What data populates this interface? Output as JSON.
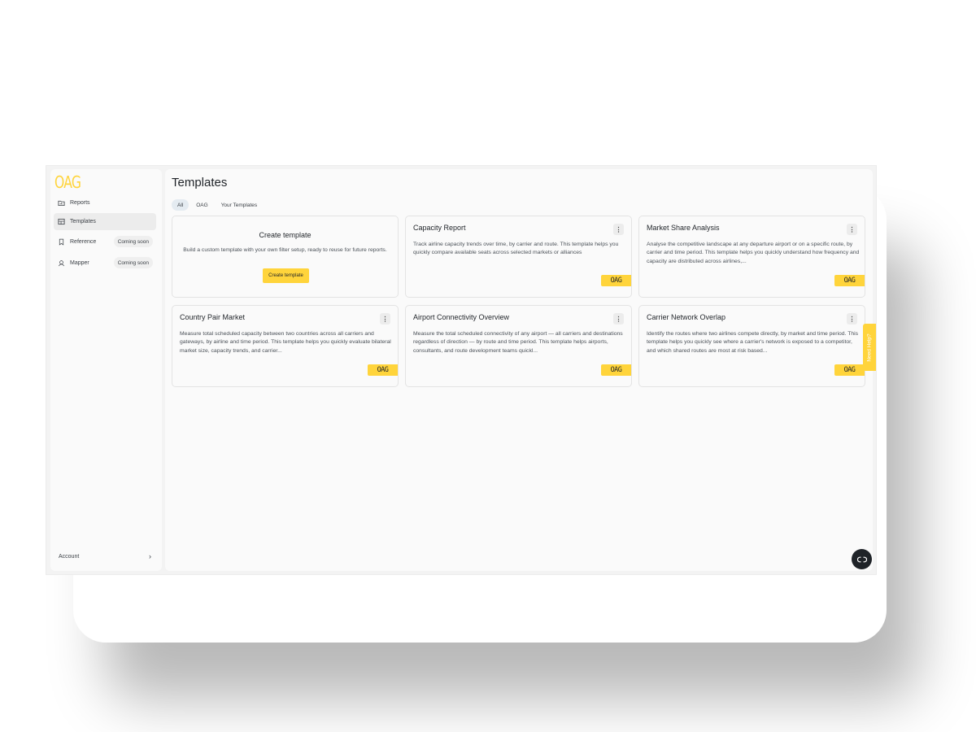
{
  "brand": {
    "logo_text": "OAG",
    "accent_color": "#ffd43b"
  },
  "sidebar": {
    "items": [
      {
        "label": "Reports",
        "icon": "folder-chart-icon",
        "active": false,
        "badge": ""
      },
      {
        "label": "Templates",
        "icon": "template-icon",
        "active": true,
        "badge": ""
      },
      {
        "label": "Reference",
        "icon": "bookmark-icon",
        "active": false,
        "badge": "Coming soon"
      },
      {
        "label": "Mapper",
        "icon": "map-pin-icon",
        "active": false,
        "badge": "Coming soon"
      }
    ],
    "account_label": "Account",
    "account_icon": "chevron-right-icon"
  },
  "main": {
    "title": "Templates",
    "filters": [
      {
        "label": "All",
        "active": true
      },
      {
        "label": "OAG",
        "active": false
      },
      {
        "label": "Your Templates",
        "active": false
      }
    ],
    "create_card": {
      "title": "Create template",
      "description": "Build a custom template with your own filter setup, ready to reuse for future reports.",
      "button_label": "Create template"
    },
    "cards": [
      {
        "title": "Capacity Report",
        "description": "Track airline capacity trends over time, by carrier and route. This template helps you quickly compare available seats across selected markets or alliances",
        "tag": "OAG",
        "menu_icon": "kebab-icon"
      },
      {
        "title": "Market Share Analysis",
        "description": "Analyse the competitive landscape at any departure airport or on a specific route, by carrier and time period. This template helps you quickly understand how frequency and capacity are distributed across airlines,...",
        "tag": "OAG",
        "menu_icon": "kebab-icon"
      },
      {
        "title": "Country Pair Market",
        "description": "Measure total scheduled capacity between two countries across all carriers and gateways, by airline and time period. This template helps you quickly evaluate bilateral market size, capacity trends, and carrier...",
        "tag": "OAG",
        "menu_icon": "kebab-icon"
      },
      {
        "title": "Airport Connectivity Overview",
        "description": "Measure the total scheduled connectivity of any airport — all carriers and destinations regardless of direction — by route and time period. This template helps airports, consultants, and route development teams quickl...",
        "tag": "OAG",
        "menu_icon": "kebab-icon"
      },
      {
        "title": "Carrier Network Overlap",
        "description": "Identify the routes where two airlines compete directly, by market and time period. This template helps you quickly see where a carrier's network is exposed to a competitor, and which shared routes are most at risk based...",
        "tag": "OAG",
        "menu_icon": "kebab-icon"
      }
    ]
  },
  "help_tab_label": "Need Help?",
  "chat_icon": "chat-link-icon"
}
